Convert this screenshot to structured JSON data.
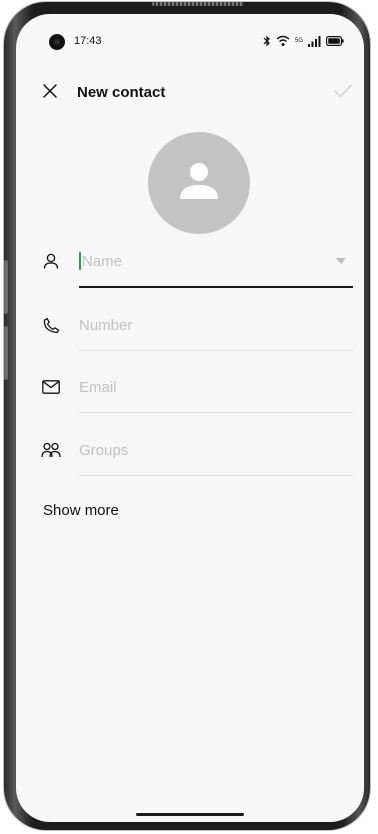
{
  "status_bar": {
    "time": "17:43",
    "network_label": "5G",
    "icons": [
      "bluetooth-icon",
      "wifi-icon",
      "cellular-signal-icon",
      "battery-icon"
    ]
  },
  "header": {
    "title": "New contact",
    "close_icon": "close-icon",
    "done_icon": "checkmark-icon"
  },
  "avatar": {
    "icon": "person-icon"
  },
  "fields": [
    {
      "name": "name",
      "icon": "person-outline-icon",
      "value": "",
      "placeholder": "Name",
      "has_dropdown": true
    },
    {
      "name": "number",
      "icon": "phone-icon",
      "value": "",
      "placeholder": "Number"
    },
    {
      "name": "email",
      "icon": "mail-icon",
      "value": "",
      "placeholder": "Email"
    },
    {
      "name": "groups",
      "icon": "groups-icon",
      "value": "",
      "placeholder": "Groups"
    }
  ],
  "show_more_label": "Show more",
  "colors": {
    "background": "#f8f8f8",
    "accent_cursor": "#2e9e4b",
    "avatar_bg": "#c4c4c4",
    "placeholder": "#c2c2c2"
  }
}
